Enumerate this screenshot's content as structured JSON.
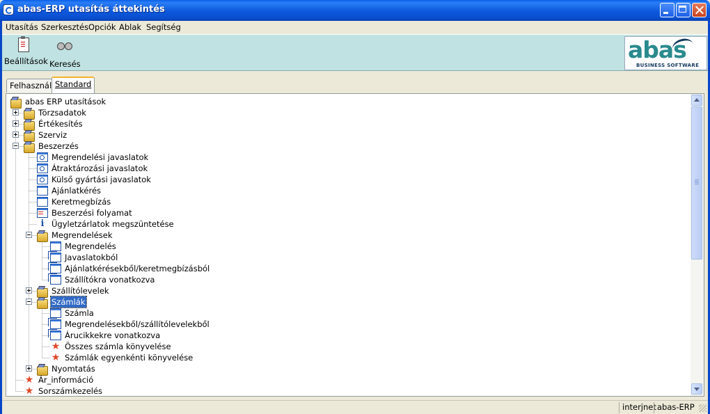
{
  "window": {
    "title": "abas-ERP utasítás áttekintés"
  },
  "menu": [
    "Utasítás",
    "Szerkesztés",
    "Opciók",
    "Ablak",
    "Segítség"
  ],
  "toolbar": {
    "settings_label": "Beállítások",
    "search_label": "Keresés"
  },
  "logo": {
    "word": "abas",
    "sub": "BUSINESS SOFTWARE"
  },
  "tabs": [
    {
      "label": "Felhasználó"
    },
    {
      "label": "Standard"
    }
  ],
  "tree": [
    {
      "label": "abas ERP utasítások",
      "icon": "folder-open-icon"
    },
    {
      "label": "Törzsadatok",
      "icon": "folder-icon",
      "state": "collapsed"
    },
    {
      "label": "Értékesítés",
      "icon": "folder-icon",
      "state": "collapsed"
    },
    {
      "label": "Szerviz",
      "icon": "folder-icon",
      "state": "collapsed"
    },
    {
      "label": "Beszerzés",
      "icon": "folder-open-icon",
      "state": "expanded"
    },
    {
      "label": "Megrendelési javaslatok",
      "icon": "search-form-icon"
    },
    {
      "label": "Átraktározási javaslatok",
      "icon": "search-form-icon"
    },
    {
      "label": "Külső gyártási javaslatok",
      "icon": "search-form-icon"
    },
    {
      "label": "Ajánlatkérés",
      "icon": "form-icon"
    },
    {
      "label": "Keretmegbízás",
      "icon": "form-icon"
    },
    {
      "label": "Beszerzési folyamat",
      "icon": "list-form-icon"
    },
    {
      "label": "Ügyletzárlatok megszüntetése",
      "icon": "info-icon"
    },
    {
      "label": "Megrendelések",
      "icon": "folder-open-icon",
      "state": "expanded"
    },
    {
      "label": "Megrendelés",
      "icon": "form-icon"
    },
    {
      "label": "Javaslatokból",
      "icon": "multi-form-icon"
    },
    {
      "label": "Ajánlatkérésekből/keretmegbízásból",
      "icon": "multi-form-icon"
    },
    {
      "label": "Szállítókra vonatkozva",
      "icon": "multi-form-icon"
    },
    {
      "label": "Szállítólevelek",
      "icon": "folder-icon",
      "state": "collapsed"
    },
    {
      "label": "Számlák",
      "icon": "folder-open-icon",
      "state": "expanded",
      "selected": true
    },
    {
      "label": "Számla",
      "icon": "form-icon"
    },
    {
      "label": "Megrendelésekből/szállítólevelekből",
      "icon": "multi-form-icon"
    },
    {
      "label": "Árucikkekre vonatkozva",
      "icon": "multi-form-icon"
    },
    {
      "label": "Összes számla könyvelése",
      "icon": "star-icon"
    },
    {
      "label": "Számlák egyenkénti könyvelése",
      "icon": "star-icon"
    },
    {
      "label": "Nyomtatás",
      "icon": "folder-icon",
      "state": "collapsed"
    },
    {
      "label": "Ár_információ",
      "icon": "star-icon"
    },
    {
      "label": "Sorszámkezelés",
      "icon": "star-icon"
    }
  ],
  "status": {
    "zone": "interjnet",
    "app": "abas-ERP"
  }
}
